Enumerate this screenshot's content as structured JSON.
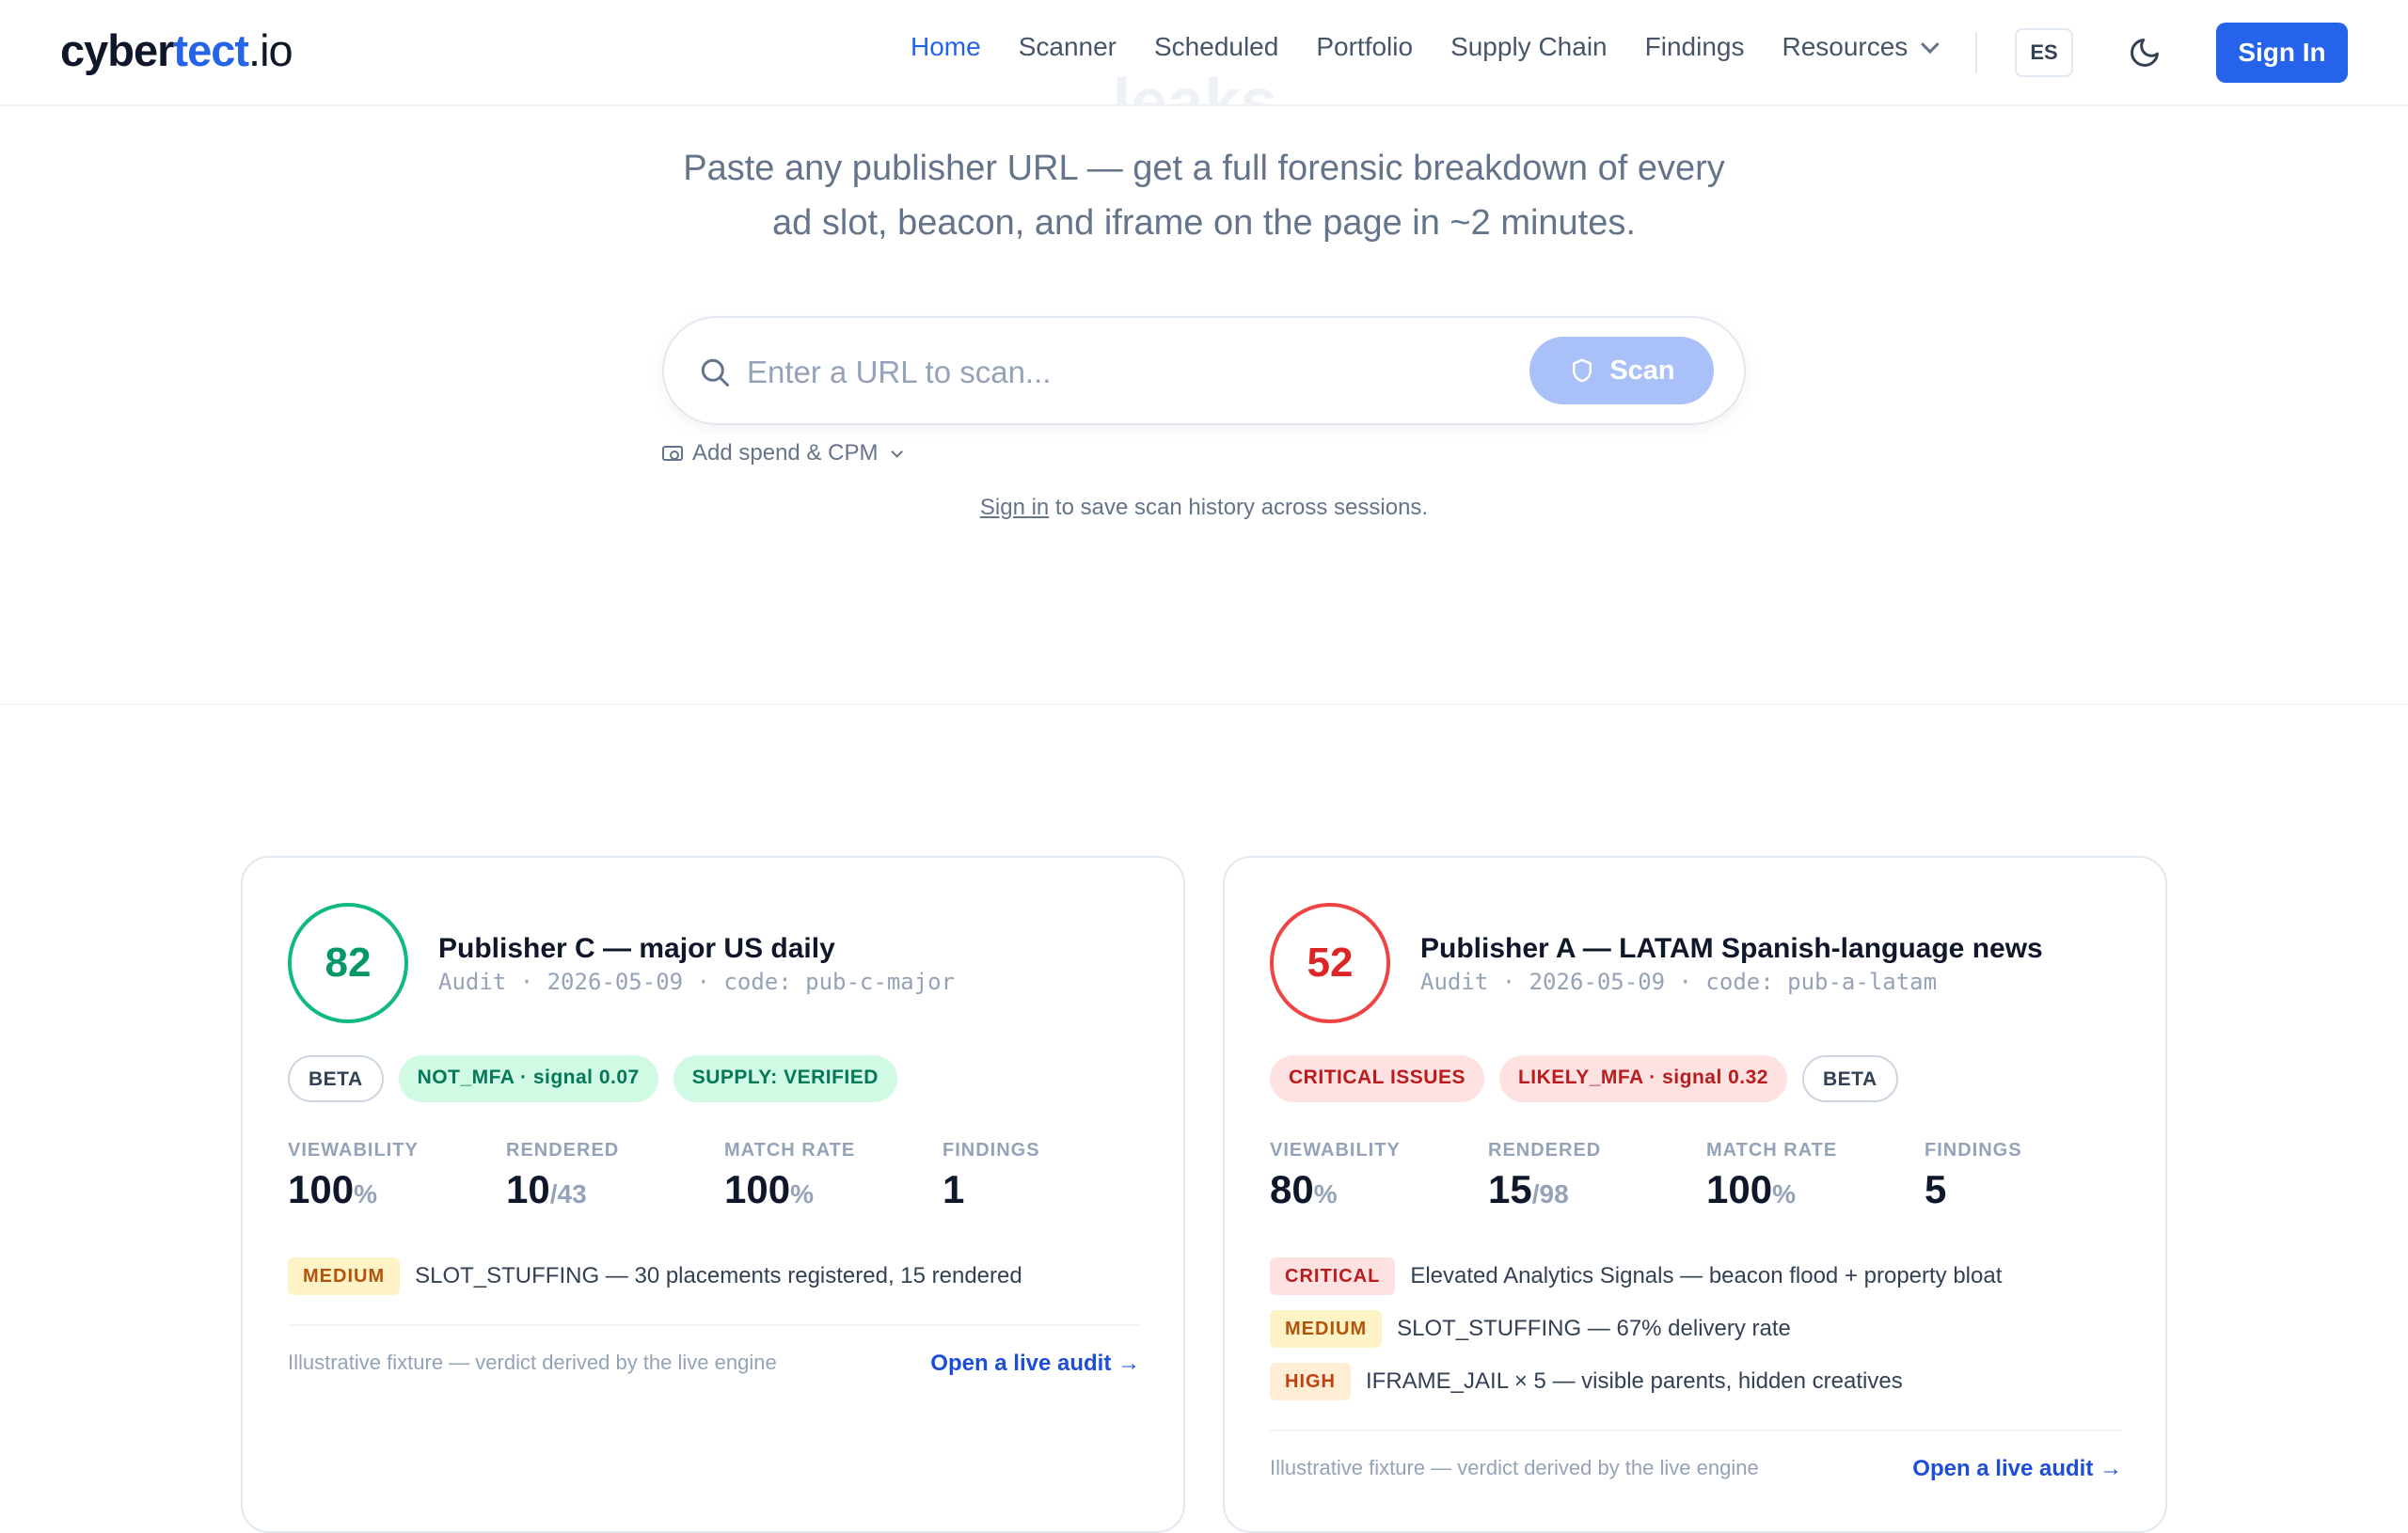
{
  "nav": {
    "logo": {
      "part1": "cyber",
      "part2": "tect",
      "part3": ".io"
    },
    "links": [
      {
        "label": "Home",
        "active": true
      },
      {
        "label": "Scanner"
      },
      {
        "label": "Scheduled"
      },
      {
        "label": "Portfolio"
      },
      {
        "label": "Supply Chain"
      },
      {
        "label": "Findings"
      },
      {
        "label": "Resources",
        "dropdown": true
      }
    ],
    "language": "ES",
    "theme_icon": "moon-icon",
    "sign_in_label": "Sign In"
  },
  "hero": {
    "ghost_heading_bottom": "leaks.",
    "subtitle_line1": "Paste any publisher URL — get a full forensic breakdown of every",
    "subtitle_line2": "ad slot, beacon, and iframe on the page in ~2 minutes.",
    "search_placeholder": "Enter a URL to scan...",
    "scan_label": "Scan",
    "spend_label": "Add spend & CPM",
    "history_link": "Sign in",
    "history_text": " to save scan history across sessions."
  },
  "cards": [
    {
      "score": "82",
      "title": "Publisher C — major US daily",
      "meta": "Audit · 2026-05-09 · code: pub-c-major",
      "badges": [
        "BETA",
        "NOT_MFA · signal 0.07",
        "SUPPLY: VERIFIED"
      ],
      "stats": [
        {
          "label": "VIEWABILITY",
          "value": "100",
          "unit": "%"
        },
        {
          "label": "RENDERED",
          "value": "10",
          "unit": "/43"
        },
        {
          "label": "MATCH RATE",
          "value": "100",
          "unit": "%"
        },
        {
          "label": "FINDINGS",
          "value": "1",
          "unit": ""
        }
      ],
      "findings": [
        {
          "severity": "MEDIUM",
          "text": "SLOT_STUFFING — 30 placements registered, 15 rendered"
        }
      ],
      "foot_note": "Illustrative fixture — verdict derived by the live engine",
      "foot_link": "Open a live audit →"
    },
    {
      "score": "52",
      "title": "Publisher A — LATAM Spanish-language news",
      "meta": "Audit · 2026-05-09 · code: pub-a-latam",
      "badges": [
        "CRITICAL ISSUES",
        "LIKELY_MFA · signal 0.32",
        "BETA"
      ],
      "stats": [
        {
          "label": "VIEWABILITY",
          "value": "80",
          "unit": "%"
        },
        {
          "label": "RENDERED",
          "value": "15",
          "unit": "/98"
        },
        {
          "label": "MATCH RATE",
          "value": "100",
          "unit": "%"
        },
        {
          "label": "FINDINGS",
          "value": "5",
          "unit": ""
        }
      ],
      "findings": [
        {
          "severity": "CRITICAL",
          "text": "Elevated Analytics Signals — beacon flood + property bloat"
        },
        {
          "severity": "MEDIUM",
          "text": "SLOT_STUFFING — 67% delivery rate"
        },
        {
          "severity": "HIGH",
          "text": "IFRAME_JAIL × 5 — visible parents, hidden creatives"
        }
      ],
      "foot_note": "Illustrative fixture — verdict derived by the live engine",
      "foot_link": "Open a live audit →"
    }
  ],
  "colors": {
    "accent": "#2563eb",
    "good": "#10b981",
    "bad": "#ef4444",
    "medium": "#b45309",
    "high": "#c2410c"
  }
}
